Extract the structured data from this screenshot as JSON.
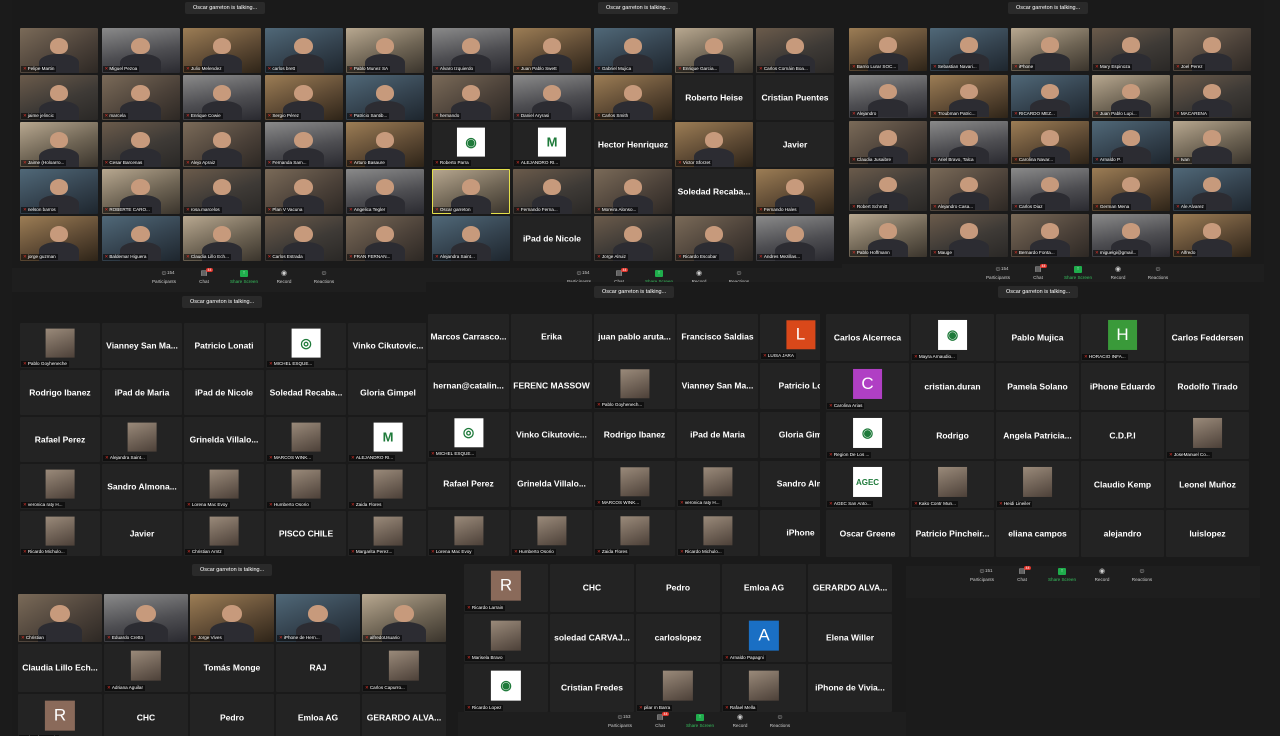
{
  "talking": "Oscar garreton is talking...",
  "toolbar": {
    "participants": "Participants",
    "chat": "Chat",
    "share": "Share Screen",
    "record": "Record",
    "reactions": "Reactions"
  },
  "windows": [
    {
      "id": "w1",
      "count": "154",
      "chat_badge": "44",
      "tiles": [
        {
          "name": "Felipe Martin",
          "kind": "video"
        },
        {
          "name": "Miguel Pezoa",
          "kind": "video"
        },
        {
          "name": "Julio Melendez",
          "kind": "video"
        },
        {
          "name": "carlos brett",
          "kind": "video"
        },
        {
          "name": "Pablo Munez SA",
          "kind": "video"
        },
        {
          "name": "jaime jelincic",
          "kind": "video"
        },
        {
          "name": "marcela",
          "kind": "video"
        },
        {
          "name": "Enrique Cowie",
          "kind": "video"
        },
        {
          "name": "Sergio Pérez",
          "kind": "video"
        },
        {
          "name": "Patricio Santib...",
          "kind": "video"
        },
        {
          "name": "Jaime (Holoarro...",
          "kind": "video"
        },
        {
          "name": "Cesar Barcenas",
          "kind": "video"
        },
        {
          "name": "Alejo Apraiz",
          "kind": "video"
        },
        {
          "name": "Fernanda Sam...",
          "kind": "video"
        },
        {
          "name": "Arturo Basaure",
          "kind": "video"
        },
        {
          "name": "nelson barros",
          "kind": "video"
        },
        {
          "name": "ROBERTE CARO...",
          "kind": "video"
        },
        {
          "name": "rosa.marcelos",
          "kind": "video"
        },
        {
          "name": "Plan V Vacuna",
          "kind": "video"
        },
        {
          "name": "Angelica Tegler",
          "kind": "video"
        },
        {
          "name": "jorge guzman",
          "kind": "video"
        },
        {
          "name": "Baldemar Higuera",
          "kind": "video"
        },
        {
          "name": "Claudia Lillo Ech...",
          "kind": "video"
        },
        {
          "name": "Carlos Estrada",
          "kind": "video"
        },
        {
          "name": "FRAN FERNAN...",
          "kind": "video"
        }
      ]
    },
    {
      "id": "w2",
      "count": "154",
      "chat_badge": "44",
      "tiles": [
        {
          "name": "Alvaro Izquierdo",
          "kind": "video"
        },
        {
          "name": "Juan Pablo Swett",
          "kind": "video"
        },
        {
          "name": "Gabriel Mujica",
          "kind": "video"
        },
        {
          "name": "Enrique Garcia...",
          "kind": "video"
        },
        {
          "name": "Carlos Cornáin Boa...",
          "kind": "video"
        },
        {
          "name": "hernando",
          "kind": "video"
        },
        {
          "name": "Daniel Aryrasi",
          "kind": "video"
        },
        {
          "name": "Carlos Smith",
          "kind": "video"
        },
        {
          "name": "Roberto Heise",
          "kind": "text"
        },
        {
          "name": "Cristian Puentes",
          "kind": "text"
        },
        {
          "name": "Roberto Parra",
          "kind": "logo",
          "glyph": "◉"
        },
        {
          "name": "ALEJANDRO RI...",
          "kind": "logo",
          "glyph": "M"
        },
        {
          "name": "Hector Henriquez",
          "kind": "text"
        },
        {
          "name": "Victor Sforzet",
          "kind": "video"
        },
        {
          "name": "Javier",
          "kind": "text"
        },
        {
          "name": "Oscar garreton",
          "kind": "video",
          "active": true
        },
        {
          "name": "Fernando Ferna...",
          "kind": "video"
        },
        {
          "name": "Moreira Alonso...",
          "kind": "video"
        },
        {
          "name": "Soledad Recaba...",
          "kind": "text"
        },
        {
          "name": "Fernando Hales",
          "kind": "video"
        },
        {
          "name": "Alejandra Saint...",
          "kind": "video"
        },
        {
          "name": "iPad de Nicole",
          "kind": "text"
        },
        {
          "name": "Jorge Alruiz",
          "kind": "video"
        },
        {
          "name": "Ricardo Escobar",
          "kind": "video"
        },
        {
          "name": "Andres Mezillas...",
          "kind": "video"
        }
      ]
    },
    {
      "id": "w3",
      "count": "154",
      "chat_badge": "44",
      "tiles": [
        {
          "name": "Barrio Lurar SOC...",
          "kind": "video"
        },
        {
          "name": "Sebastian Navari...",
          "kind": "video"
        },
        {
          "name": "iPhone",
          "kind": "video"
        },
        {
          "name": "Mary Espinoza",
          "kind": "video"
        },
        {
          "name": "Joel Perez",
          "kind": "video"
        },
        {
          "name": "Alejandro",
          "kind": "video"
        },
        {
          "name": "Troubman Patric...",
          "kind": "video"
        },
        {
          "name": "RICARDO MEZ...",
          "kind": "video"
        },
        {
          "name": "Juan Pablo Lupi...",
          "kind": "video"
        },
        {
          "name": "MACARENA",
          "kind": "video"
        },
        {
          "name": "Claudia Jusaibre",
          "kind": "video"
        },
        {
          "name": "Ariel Bravo, Talca",
          "kind": "video"
        },
        {
          "name": "Carolina Navar...",
          "kind": "video"
        },
        {
          "name": "Arnaldo P.",
          "kind": "video"
        },
        {
          "name": "Ivan",
          "kind": "video"
        },
        {
          "name": "Robert Schmitt",
          "kind": "video"
        },
        {
          "name": "Alejandro Casa...",
          "kind": "video"
        },
        {
          "name": "Carlos Diaz",
          "kind": "video"
        },
        {
          "name": "German Mena",
          "kind": "video"
        },
        {
          "name": "Ale Alvarez",
          "kind": "video"
        },
        {
          "name": "Pablo Hoffmann",
          "kind": "video"
        },
        {
          "name": "Mauge",
          "kind": "video"
        },
        {
          "name": "Bernardo Fonta...",
          "kind": "video"
        },
        {
          "name": "miguelgi@gmail...",
          "kind": "video"
        },
        {
          "name": "Alfredo",
          "kind": "video"
        }
      ]
    },
    {
      "id": "w4",
      "count": "154",
      "chat_badge": "44",
      "tiles": [
        {
          "name": "Pablo Goyheneche",
          "kind": "img"
        },
        {
          "name": "Vianney San Ma...",
          "kind": "text"
        },
        {
          "name": "Patricio Lonati",
          "kind": "text"
        },
        {
          "name": "MICHEL ESQUE...",
          "kind": "logo",
          "glyph": "◎"
        },
        {
          "name": "Vinko Cikutovic...",
          "kind": "text"
        },
        {
          "name": "Rodrigo Ibanez",
          "kind": "text"
        },
        {
          "name": "iPad de Maria",
          "kind": "text"
        },
        {
          "name": "iPad de Nicole",
          "kind": "text"
        },
        {
          "name": "Soledad Recaba...",
          "kind": "text"
        },
        {
          "name": "Gloria Gimpel",
          "kind": "text"
        },
        {
          "name": "Rafael Perez",
          "kind": "text"
        },
        {
          "name": "Alejandra Saint...",
          "kind": "img"
        },
        {
          "name": "Grinelda Villalo...",
          "kind": "text"
        },
        {
          "name": "MARCOS WINK...",
          "kind": "img"
        },
        {
          "name": "ALEJANDRO RI...",
          "kind": "logo",
          "glyph": "M"
        },
        {
          "name": "veronica raty H...",
          "kind": "img"
        },
        {
          "name": "Sandro Almona...",
          "kind": "text"
        },
        {
          "name": "Lorena Mac Evoy",
          "kind": "img"
        },
        {
          "name": "Humberto Osorio",
          "kind": "img"
        },
        {
          "name": "Zaida Flores",
          "kind": "img"
        },
        {
          "name": "Ricardo Michulo...",
          "kind": "img"
        },
        {
          "name": "Javier",
          "kind": "text"
        },
        {
          "name": "Christian Arntz",
          "kind": "img"
        },
        {
          "name": "PISCO CHILE",
          "kind": "text"
        },
        {
          "name": "Margarita Perez...",
          "kind": "img"
        }
      ]
    },
    {
      "id": "w5",
      "count": "154",
      "chat_badge": "44",
      "tiles": [
        {
          "name": "Marcos Carrasco...",
          "kind": "text"
        },
        {
          "name": "Erika",
          "kind": "text"
        },
        {
          "name": "juan pablo aruta...",
          "kind": "text"
        },
        {
          "name": "Francisco Saldias",
          "kind": "text"
        },
        {
          "name": "LUISA JARA",
          "kind": "letter",
          "glyph": "L",
          "color": "#d9481a"
        },
        {
          "name": "hernan@catalin...",
          "kind": "text"
        },
        {
          "name": "FERENC MASSOW",
          "kind": "text"
        },
        {
          "name": "Pablo Goyhenech...",
          "kind": "img"
        },
        {
          "name": "Vianney San Ma...",
          "kind": "text"
        },
        {
          "name": "Patricio Lo",
          "kind": "text"
        },
        {
          "name": "MICHEL ESQUE...",
          "kind": "logo",
          "glyph": "◎"
        },
        {
          "name": "Vinko Cikutovic...",
          "kind": "text"
        },
        {
          "name": "Rodrigo Ibanez",
          "kind": "text"
        },
        {
          "name": "iPad de Maria",
          "kind": "text"
        },
        {
          "name": "Gloria Gim",
          "kind": "text"
        },
        {
          "name": "Rafael Perez",
          "kind": "text"
        },
        {
          "name": "Grinelda Villalo...",
          "kind": "text"
        },
        {
          "name": "MARCOS WINK...",
          "kind": "img"
        },
        {
          "name": "veronica raty H...",
          "kind": "img"
        },
        {
          "name": "Sandro Alm",
          "kind": "text"
        },
        {
          "name": "Lorena Mac Evoy",
          "kind": "img"
        },
        {
          "name": "Humberto Osorio",
          "kind": "img"
        },
        {
          "name": "Zaida Flores",
          "kind": "img"
        },
        {
          "name": "Ricardo Michulo...",
          "kind": "img"
        },
        {
          "name": "iPhone",
          "kind": "text"
        }
      ]
    },
    {
      "id": "w6",
      "count": "151",
      "chat_badge": "44",
      "tiles": [
        {
          "name": "Carlos Alcerreca",
          "kind": "text"
        },
        {
          "name": "Mayra Arnaudio...",
          "kind": "logo",
          "glyph": "◉"
        },
        {
          "name": "Pablo Mujica",
          "kind": "text"
        },
        {
          "name": "HORACIO INFA...",
          "kind": "letter",
          "glyph": "H",
          "color": "#3a9a3a"
        },
        {
          "name": "Carlos Feddersen",
          "kind": "text"
        },
        {
          "name": "Carolina Arias",
          "kind": "letter",
          "glyph": "C",
          "color": "#b03fc4"
        },
        {
          "name": "cristian.duran",
          "kind": "text"
        },
        {
          "name": "Pamela Solano",
          "kind": "text"
        },
        {
          "name": "iPhone Eduardo",
          "kind": "text"
        },
        {
          "name": "Rodolfo Tirado",
          "kind": "text"
        },
        {
          "name": "Region De Los ...",
          "kind": "logo",
          "glyph": "◉"
        },
        {
          "name": "Rodrigo",
          "kind": "text"
        },
        {
          "name": "Angela Patricia...",
          "kind": "text"
        },
        {
          "name": "C.D.P.I",
          "kind": "text"
        },
        {
          "name": "JoseManuel Co...",
          "kind": "img"
        },
        {
          "name": "AGEC San Anto...",
          "kind": "logo",
          "glyph": "AGEC"
        },
        {
          "name": "Kako Contr Mun...",
          "kind": "img"
        },
        {
          "name": "Heidi Lineiler",
          "kind": "img"
        },
        {
          "name": "Claudio Kemp",
          "kind": "text"
        },
        {
          "name": "Leonel Muñoz",
          "kind": "text"
        },
        {
          "name": "Oscar Greene",
          "kind": "text"
        },
        {
          "name": "Patricio Pincheir...",
          "kind": "text"
        },
        {
          "name": "eliana campos",
          "kind": "text"
        },
        {
          "name": "alejandro",
          "kind": "text"
        },
        {
          "name": "luislopez",
          "kind": "text"
        }
      ]
    },
    {
      "id": "w7",
      "tiles": [
        {
          "name": "Christian",
          "kind": "video"
        },
        {
          "name": "Eduardo Cretto",
          "kind": "video"
        },
        {
          "name": "Jorge Vives",
          "kind": "video"
        },
        {
          "name": "iPhone de Hern...",
          "kind": "video"
        },
        {
          "name": "alfredoUsuario",
          "kind": "video"
        },
        {
          "name": "Claudia Lillo Ech...",
          "kind": "text"
        },
        {
          "name": "Adriana Aguilar",
          "kind": "img"
        },
        {
          "name": "Tomás Monge",
          "kind": "text"
        },
        {
          "name": "RAJ",
          "kind": "text"
        },
        {
          "name": "Carlos Capurro...",
          "kind": "img"
        },
        {
          "name": "Ricardo Larrain",
          "kind": "letter",
          "glyph": "R",
          "color": "#8a6a5a"
        },
        {
          "name": "CHC",
          "kind": "text"
        },
        {
          "name": "Pedro",
          "kind": "text"
        },
        {
          "name": "Emloa AG",
          "kind": "text"
        },
        {
          "name": "GERARDO ALVA...",
          "kind": "text"
        }
      ]
    },
    {
      "id": "w8",
      "count": "153",
      "chat_badge": "44",
      "tiles": [
        {
          "name": "Ricardo Larrain",
          "kind": "letter",
          "glyph": "R",
          "color": "#8a6a5a"
        },
        {
          "name": "CHC",
          "kind": "text"
        },
        {
          "name": "Pedro",
          "kind": "text"
        },
        {
          "name": "Emloa AG",
          "kind": "text"
        },
        {
          "name": "GERARDO ALVA...",
          "kind": "text"
        },
        {
          "name": "Marisela Bravo",
          "kind": "img"
        },
        {
          "name": "soledad CARVAJ...",
          "kind": "text"
        },
        {
          "name": "carloslopez",
          "kind": "text"
        },
        {
          "name": "Arnaldo Papagni",
          "kind": "letter",
          "glyph": "A",
          "color": "#1a6fc4"
        },
        {
          "name": "Elena Willer",
          "kind": "text"
        },
        {
          "name": "Ricardo Lopez",
          "kind": "logo",
          "glyph": "◉"
        },
        {
          "name": "Cristian Fredes",
          "kind": "text"
        },
        {
          "name": "pilar m Barra",
          "kind": "img"
        },
        {
          "name": "Rafael Mella",
          "kind": "img"
        },
        {
          "name": "iPhone de Vivia...",
          "kind": "text"
        }
      ]
    }
  ]
}
